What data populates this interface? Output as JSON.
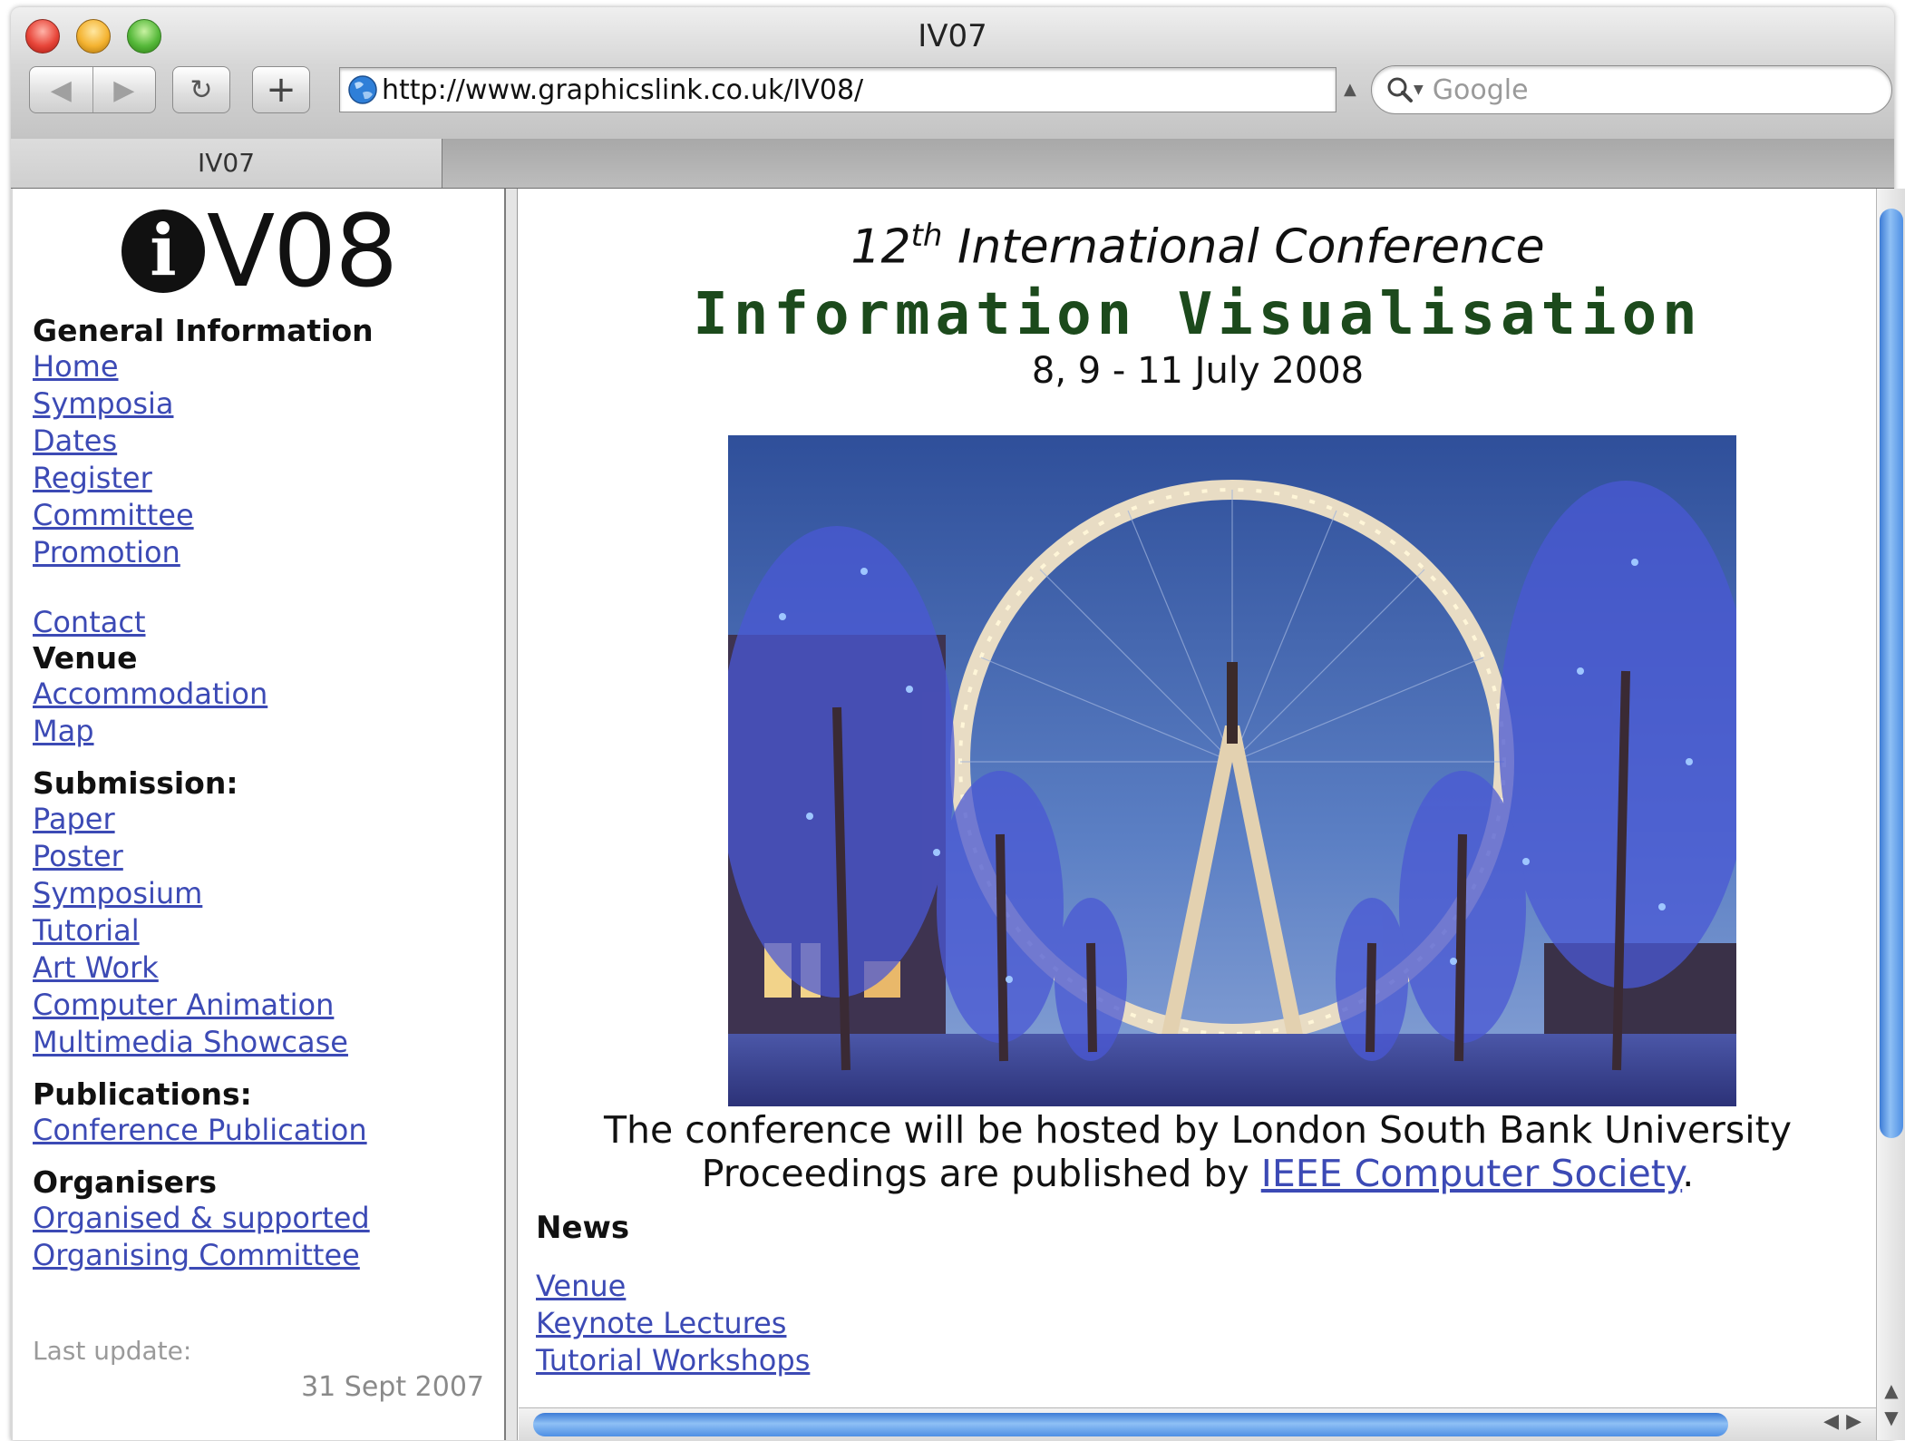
{
  "window": {
    "title": "IV07"
  },
  "toolbar": {
    "back_icon": "◀",
    "forward_icon": "▶",
    "reload_icon": "↻",
    "add_icon": "+",
    "url": "http://www.graphicslink.co.uk/IV08/",
    "search_placeholder": "Google"
  },
  "tabs": [
    {
      "label": "IV07"
    }
  ],
  "sidebar": {
    "logo_i": "i",
    "logo_text": "V08",
    "general_heading": "General Information",
    "general_links": [
      "Home",
      "Symposia",
      "Dates",
      "Register",
      "Committee",
      "Promotion"
    ],
    "contact_link": "Contact",
    "venue_heading": "Venue",
    "venue_links": [
      "Accommodation",
      "Map"
    ],
    "submission_heading": "Submission:",
    "submission_links": [
      "Paper",
      "Poster",
      "Symposium",
      "Tutorial",
      "Art Work",
      "Computer Animation",
      "Multimedia Showcase"
    ],
    "publications_heading": "Publications:",
    "publications_links": [
      "Conference Publication"
    ],
    "organisers_heading": "Organisers",
    "organisers_links": [
      "Organised & supported",
      "Organising Committee"
    ],
    "last_update_label": "Last update:",
    "last_update_date": "31 Sept 2007"
  },
  "main": {
    "ordinal": "12",
    "ordinal_suffix": "th",
    "conference_type": "International Conference",
    "conference_name": "Information Visualisation",
    "dates": "8, 9 - 11 July 2008",
    "host_text": "The conference will be hosted by London South Bank University",
    "proceedings_prefix": "Proceedings are published by ",
    "proceedings_link": "IEEE Computer Society",
    "proceedings_suffix": ".",
    "news_heading": "News",
    "news_links": [
      "Venue",
      "Keynote Lectures",
      "Tutorial Workshops"
    ]
  },
  "colors": {
    "link": "#3c4ab5",
    "conference_name": "#1c4a1c",
    "scroll_thumb": "#4e8fe4"
  }
}
